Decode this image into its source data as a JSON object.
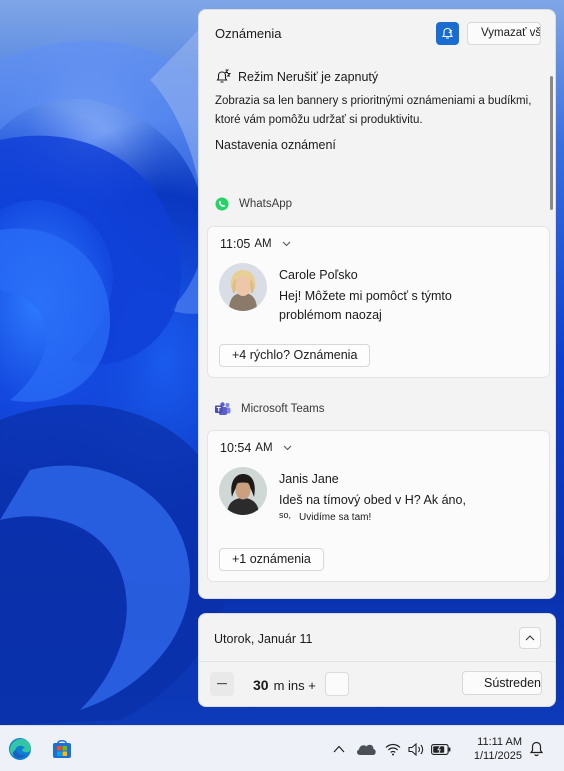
{
  "notifications": {
    "title": "Oznámenia",
    "focus_icon": "bell-snooze-icon",
    "clear_all_label": "Vymazať všetko",
    "dnd": {
      "icon": "bell-zz-icon",
      "title": "Režim Nerušiť je zapnutý",
      "description_line1": "Zobrazia sa len bannery s prioritnými oznámeniami a budíkmi,",
      "description_line2": "ktoré vám pomôžu udržať si produktivitu.",
      "settings_link": "Nastavenia oznámení"
    },
    "groups": [
      {
        "app_name": "WhatsApp",
        "app_icon": "whatsapp-icon",
        "time": "11:05",
        "ampm": "AM",
        "sender": "Carole Poľsko",
        "message_line1": "Hej! Môžete mi pomôcť s týmto",
        "message_line2": "problémom naozaj",
        "more_label": "+4 rýchlo? Oznámenia"
      },
      {
        "app_name": "Microsoft Teams",
        "app_icon": "teams-icon",
        "time": "10:54",
        "ampm": "AM",
        "sender": "Janis Jane",
        "message_line1": "Ideš na tímový obed v H? Ak áno,",
        "message_small_prefix": "so,",
        "message_line2": "Uvidíme sa tam!",
        "more_label": "+1 oznámenia"
      }
    ]
  },
  "calendar": {
    "date_label": "Utorok, Január 11",
    "focus_minutes": "30",
    "focus_unit": "m ins +",
    "focus_button_label": "Sústredenie"
  },
  "taskbar": {
    "apps": [
      "edge-icon",
      "store-icon"
    ],
    "tray": [
      "chevron-up-icon",
      "onedrive-icon",
      "wifi-icon",
      "volume-icon",
      "battery-icon"
    ],
    "time": "11:11 AM",
    "date": "1/11/2025",
    "bell_icon": "bell-icon"
  },
  "colors": {
    "accent": "#1a6dd0",
    "whatsapp": "#25d366",
    "teams": "#5b5fc7"
  }
}
